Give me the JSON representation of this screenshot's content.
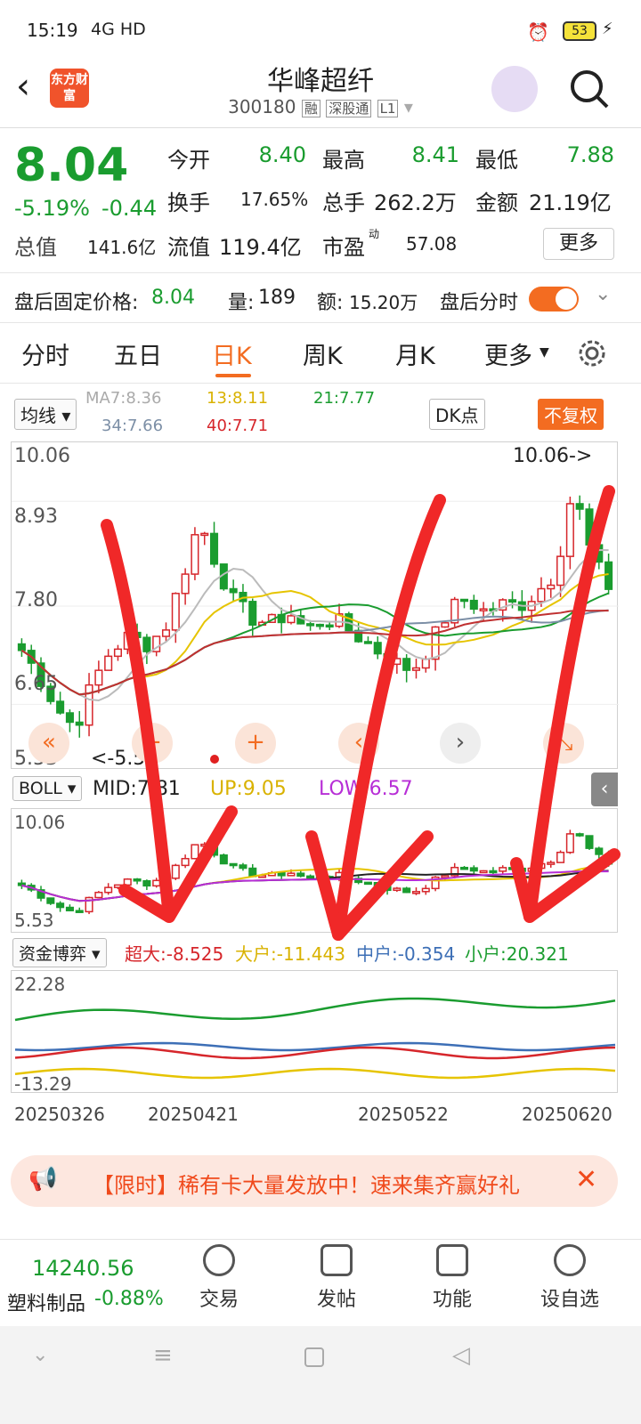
{
  "status": {
    "time": "15:19",
    "network": "4G HD",
    "battery": "53"
  },
  "header": {
    "app_logo": "东方财富",
    "stock_name": "华峰超纤",
    "code": "300180",
    "tags": [
      "融",
      "深股通",
      "L1"
    ]
  },
  "quote": {
    "price": "8.04",
    "pct": "-5.19%",
    "change": "-0.44",
    "open_label": "今开",
    "open": "8.40",
    "high_label": "最高",
    "high": "8.41",
    "low_label": "最低",
    "low": "7.88",
    "turnover_label": "换手",
    "turnover": "17.65%",
    "volume_label": "总手",
    "volume": "262.2万",
    "amount_label": "金额",
    "amount": "21.19亿",
    "mktcap_label": "总值",
    "mktcap": "141.6亿",
    "float_label": "流值",
    "float": "119.4亿",
    "pe_label": "市盈",
    "pe_sup": "动",
    "pe": "57.08",
    "more": "更多"
  },
  "afterhours": {
    "price_label": "盘后固定价格:",
    "price": "8.04",
    "vol_label": "量:",
    "vol": "189",
    "amt_label": "额:",
    "amt": "15.20万",
    "toggle_label": "盘后分时"
  },
  "tabs": [
    "分时",
    "五日",
    "日K",
    "周K",
    "月K",
    "更多"
  ],
  "kline": {
    "indicator": "均线",
    "ma7": "MA7:8.36",
    "ma13": "13:8.11",
    "ma21": "21:7.77",
    "ma34": "34:7.66",
    "ma40": "40:7.71",
    "dk": "DK点",
    "fuquan": "不复权",
    "ymax": "10.06",
    "ymid": "8.93",
    "ylow": "7.80",
    "ymin": "5.53",
    "y4": "6.65",
    "max_mark": "10.06->",
    "min_mark": "<-5.53"
  },
  "boll": {
    "label": "BOLL",
    "mid": "MID:7.81",
    "up": "UP:9.05",
    "low": "LOW:6.57",
    "ymax": "10.06",
    "ymin": "5.53"
  },
  "fund": {
    "label": "资金博弈",
    "super": "超大:-8.525",
    "large": "大户:-11.443",
    "mid": "中户:-0.354",
    "small": "小户:20.321",
    "ymax": "22.28",
    "ymin": "-13.29"
  },
  "dates": [
    "20250326",
    "20250421",
    "20250522",
    "20250620"
  ],
  "banner": {
    "text": "【限时】稀有卡大量发放中！速来集齐赢好礼"
  },
  "bottom": {
    "index": "14240.56",
    "sector": "塑料制品",
    "sector_pct": "-0.88%",
    "trade": "交易",
    "post": "发帖",
    "func": "功能",
    "fav": "设自选"
  },
  "chart_data": {
    "type": "candlestick",
    "ymax": 10.06,
    "ymin": 5.53,
    "last_close": 8.04,
    "x_ticks": [
      "20250326",
      "20250421",
      "20250522",
      "20250620"
    ]
  },
  "colors": {
    "up": "#d6262b",
    "down": "#1a9c2f",
    "accent": "#f36c21",
    "arrow": "#f02828"
  }
}
